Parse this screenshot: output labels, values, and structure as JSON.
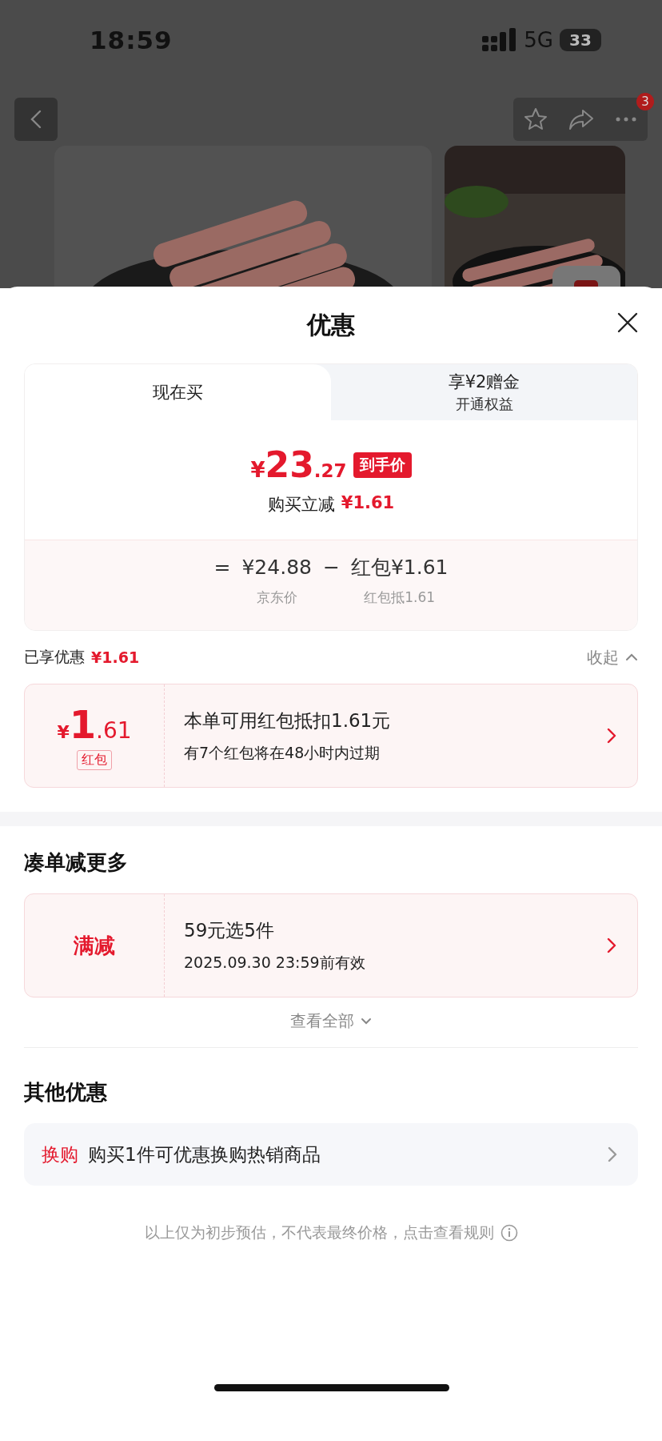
{
  "status_bar": {
    "time": "18:59",
    "network": "5G",
    "battery": "33"
  },
  "nav": {
    "more_badge": "3"
  },
  "sheet": {
    "title": "优惠"
  },
  "tabs": [
    {
      "label": "现在买",
      "selected": true
    },
    {
      "label": "享¥2赠金",
      "sublabel": "开通权益",
      "selected": false
    }
  ],
  "price": {
    "currency": "¥",
    "integer": "23",
    "decimal": ".27",
    "badge": "到手价",
    "instant_label": "购买立减",
    "instant_amount": "¥1.61"
  },
  "breakdown": {
    "lead": "=",
    "terms": [
      {
        "value": "¥24.88",
        "caption": "京东价"
      },
      {
        "operator": "−",
        "value": "红包¥1.61",
        "caption": "红包抵1.61"
      }
    ]
  },
  "enjoyed": {
    "label": "已享优惠",
    "amount": "¥1.61",
    "toggle": "收起",
    "expanded": true
  },
  "coupon": {
    "currency": "¥",
    "integer": "1",
    "decimal": ".61",
    "tag": "红包",
    "title": "本单可用红包抵扣1.61元",
    "note": "有7个红包将在48小时内过期"
  },
  "bundle": {
    "title": "凑单减更多",
    "offers": [
      {
        "tag": "满减",
        "title": "59元选5件",
        "note": "2025.09.30 23:59前有效"
      }
    ],
    "more": "查看全部"
  },
  "other": {
    "title": "其他优惠",
    "items": [
      {
        "tag": "换购",
        "text": "购买1件可优惠换购热销商品"
      }
    ]
  },
  "disclaimer": "以上仅为初步预估，不代表最终价格，点击查看规则"
}
